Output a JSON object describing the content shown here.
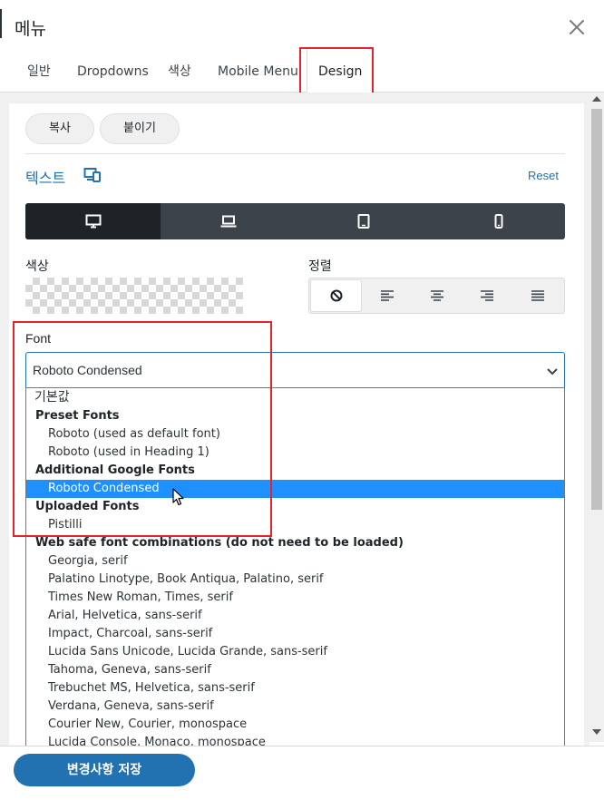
{
  "header": {
    "title": "메뉴",
    "close_icon": "close-icon"
  },
  "tabs": [
    {
      "label": "일반"
    },
    {
      "label": "Dropdowns"
    },
    {
      "label": "색상"
    },
    {
      "label": "Mobile Menu"
    },
    {
      "label": "Design",
      "active": true
    }
  ],
  "clipboard": {
    "copy_label": "복사",
    "paste_label": "붙이기"
  },
  "text_section": {
    "title": "텍스트",
    "responsive_icon": "responsive-devices-icon",
    "reset_label": "Reset",
    "devices": [
      {
        "icon": "desktop-icon",
        "active": true
      },
      {
        "icon": "laptop-icon"
      },
      {
        "icon": "tablet-icon"
      },
      {
        "icon": "mobile-icon"
      }
    ]
  },
  "color": {
    "label": "색상",
    "value": "transparent"
  },
  "alignment": {
    "label": "정렬",
    "options": [
      {
        "icon": "none-icon",
        "active": true
      },
      {
        "icon": "align-left-icon"
      },
      {
        "icon": "align-center-icon"
      },
      {
        "icon": "align-right-icon"
      },
      {
        "icon": "align-justify-icon"
      }
    ]
  },
  "font": {
    "label": "Font",
    "selected": "Roboto Condensed",
    "options": [
      {
        "type": "default",
        "label": "기본값"
      },
      {
        "type": "group",
        "label": "Preset Fonts"
      },
      {
        "type": "item",
        "label": "Roboto (used as default font)"
      },
      {
        "type": "item",
        "label": "Roboto (used in Heading 1)"
      },
      {
        "type": "group",
        "label": "Additional Google Fonts"
      },
      {
        "type": "item",
        "label": "Roboto Condensed",
        "selected": true
      },
      {
        "type": "group",
        "label": "Uploaded Fonts"
      },
      {
        "type": "item",
        "label": "Pistilli"
      },
      {
        "type": "group",
        "label": "Web safe font combinations (do not need to be loaded)"
      },
      {
        "type": "item",
        "label": "Georgia, serif"
      },
      {
        "type": "item",
        "label": "Palatino Linotype, Book Antiqua, Palatino, serif"
      },
      {
        "type": "item",
        "label": "Times New Roman, Times, serif"
      },
      {
        "type": "item",
        "label": "Arial, Helvetica, sans-serif"
      },
      {
        "type": "item",
        "label": "Impact, Charcoal, sans-serif"
      },
      {
        "type": "item",
        "label": "Lucida Sans Unicode, Lucida Grande, sans-serif"
      },
      {
        "type": "item",
        "label": "Tahoma, Geneva, sans-serif"
      },
      {
        "type": "item",
        "label": "Trebuchet MS, Helvetica, sans-serif"
      },
      {
        "type": "item",
        "label": "Verdana, Geneva, sans-serif"
      },
      {
        "type": "item",
        "label": "Courier New, Courier, monospace"
      },
      {
        "type": "item",
        "label": "Lucida Console, Monaco, monospace"
      }
    ]
  },
  "footer": {
    "save_label": "변경사항 저장"
  },
  "colors": {
    "accent": "#2271b1",
    "selected_option": "#1e90ff",
    "highlight_box": "#e3242b",
    "device_bar": "#3c434a",
    "device_active": "#1d2327"
  }
}
